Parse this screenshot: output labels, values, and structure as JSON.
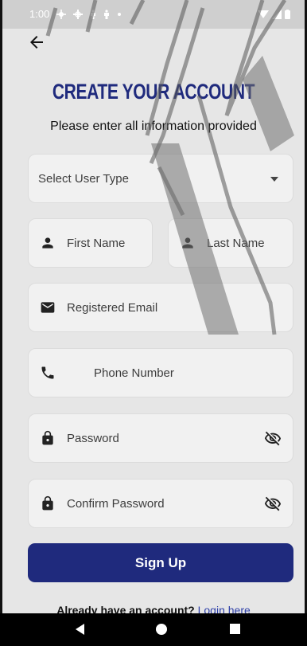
{
  "status": {
    "time": "1:00"
  },
  "header": {
    "title": "CREATE YOUR ACCOUNT",
    "subtitle": "Please enter all information provided"
  },
  "form": {
    "user_type_placeholder": "Select User Type",
    "first_name_placeholder": "First Name",
    "last_name_placeholder": "Last Name",
    "email_placeholder": "Registered Email",
    "phone_placeholder": "Phone Number",
    "password_placeholder": "Password",
    "confirm_password_placeholder": "Confirm Password",
    "signup_label": "Sign Up"
  },
  "footer": {
    "prompt": "Already have an account?",
    "link": "Login here"
  },
  "colors": {
    "accent": "#1f2a7d",
    "link": "#2c3ea8",
    "background": "#e6e6e6",
    "field": "#f1f1f1"
  },
  "icons": {
    "back": "arrow-left-icon",
    "person": "person-icon",
    "email": "mail-icon",
    "phone": "phone-icon",
    "lock": "lock-icon",
    "visibility": "eye-off-icon",
    "dropdown": "caret-down-icon"
  }
}
